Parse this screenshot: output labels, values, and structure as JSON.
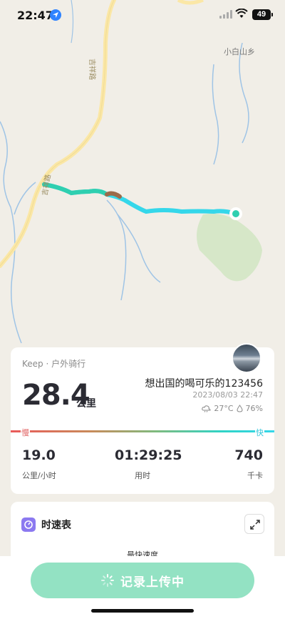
{
  "status": {
    "time": "22:47",
    "battery": "49",
    "icons": [
      "location-arrow-icon",
      "signal-icon",
      "wifi-icon",
      "battery-icon"
    ]
  },
  "map": {
    "labels": {
      "town": "小白山乡",
      "road_top": "吉祥路",
      "road_mid": "吉祥路"
    },
    "route_colors": [
      "#2fd3c6",
      "#35d7ea",
      "#9b6b4a"
    ]
  },
  "summary": {
    "source": "Keep · 户外骑行",
    "distance": "28.4",
    "distance_unit": "公里",
    "username": "想出国的喝可乐的123456",
    "datetime": "2023/08/03 22:47",
    "temperature": "27°C",
    "humidity": "76%",
    "speed_scale": {
      "slow": "慢",
      "fast": "快"
    },
    "stats": [
      {
        "value": "19.0",
        "label": "公里/小时"
      },
      {
        "value": "01:29:25",
        "label": "用时"
      },
      {
        "value": "740",
        "label": "千卡"
      }
    ]
  },
  "pace_table": {
    "title": "时速表",
    "subtitle": "最快速度"
  },
  "upload": {
    "label": "记录上传中"
  }
}
